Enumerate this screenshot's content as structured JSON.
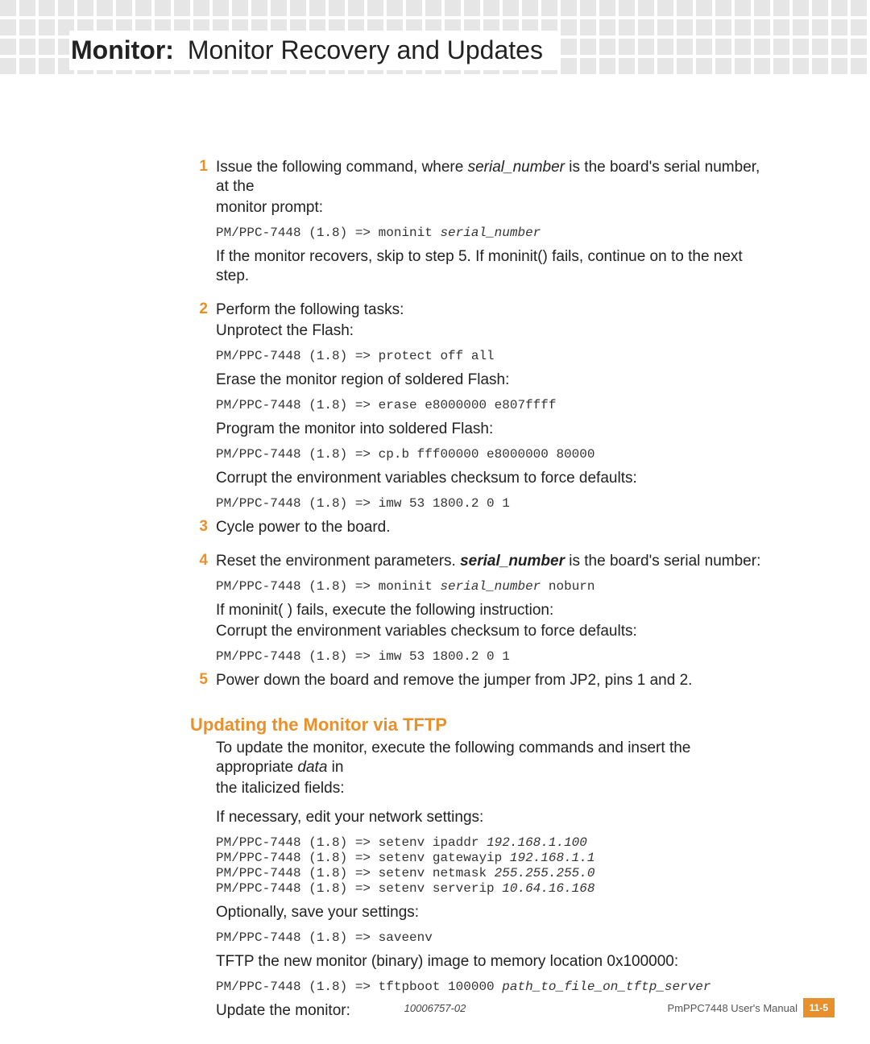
{
  "header": {
    "bold": "Monitor:",
    "light": "Monitor Recovery and Updates"
  },
  "steps": {
    "s1": {
      "num": "1",
      "l1_a": "Issue the following command, where ",
      "l1_em": "serial_number",
      "l1_b": " is the board's serial number, at the",
      "l2": "monitor prompt:",
      "code1_a": "PM/PPC-7448 (1.8) => moninit ",
      "code1_em": "serial_number",
      "l3": "If the monitor recovers, skip to step 5. If moninit() fails, continue on to the next step."
    },
    "s2": {
      "num": "2",
      "l1": "Perform the following tasks:",
      "l2": "Unprotect the Flash:",
      "code1": "PM/PPC-7448 (1.8) => protect off all",
      "l3": "Erase the monitor region of soldered Flash:",
      "code2": "PM/PPC-7448 (1.8) => erase e8000000 e807ffff",
      "l4": "Program the monitor into soldered Flash:",
      "code3": "PM/PPC-7448 (1.8) => cp.b fff00000 e8000000 80000",
      "l5": "Corrupt the environment variables checksum to force defaults:",
      "code4": "PM/PPC-7448 (1.8) => imw 53 1800.2 0 1"
    },
    "s3": {
      "num": "3",
      "l1": "Cycle power to the board."
    },
    "s4": {
      "num": "4",
      "l1_a": "Reset the environment parameters. ",
      "l1_strong": "serial_number",
      "l1_b": " is the board's serial number:",
      "code1_a": "PM/PPC-7448 (1.8) => moninit ",
      "code1_em": "serial_number",
      "code1_b": " noburn",
      "l2": "If moninit( ) fails, execute the following instruction:",
      "l3": "Corrupt the environment variables checksum to force defaults:",
      "code2": "PM/PPC-7448 (1.8) => imw 53 1800.2 0 1"
    },
    "s5": {
      "num": "5",
      "l1": "Power down the board and remove the jumper from JP2, pins 1 and 2."
    }
  },
  "section2": {
    "heading": "Updating the Monitor via TFTP",
    "l1_a": "To update the monitor, execute the following commands and insert the appropriate ",
    "l1_em": "data",
    "l1_b": " in",
    "l2": "the italicized fields:",
    "l3": "If necessary, edit your network settings:",
    "code1_a": "PM/PPC-7448 (1.8) => setenv ipaddr ",
    "code1_em": "192.168.1.100",
    "code2_a": "PM/PPC-7448 (1.8) => setenv gatewayip ",
    "code2_em": "192.168.1.1",
    "code3_a": "PM/PPC-7448 (1.8) => setenv netmask ",
    "code3_em": "255.255.255.0",
    "code4_a": "PM/PPC-7448 (1.8) => setenv serverip ",
    "code4_em": "10.64.16.168",
    "l4": "Optionally, save your settings:",
    "code5": "PM/PPC-7448 (1.8) => saveenv",
    "l5": "TFTP the new monitor (binary) image to memory location 0x100000:",
    "code6_a": "PM/PPC-7448 (1.8) => tftpboot 100000 ",
    "code6_em": "path_to_file_on_tftp_server",
    "l6": "Update the monitor:"
  },
  "footer": {
    "center": "10006757-02",
    "right": "PmPPC7448 User's Manual",
    "page": "11-5"
  }
}
